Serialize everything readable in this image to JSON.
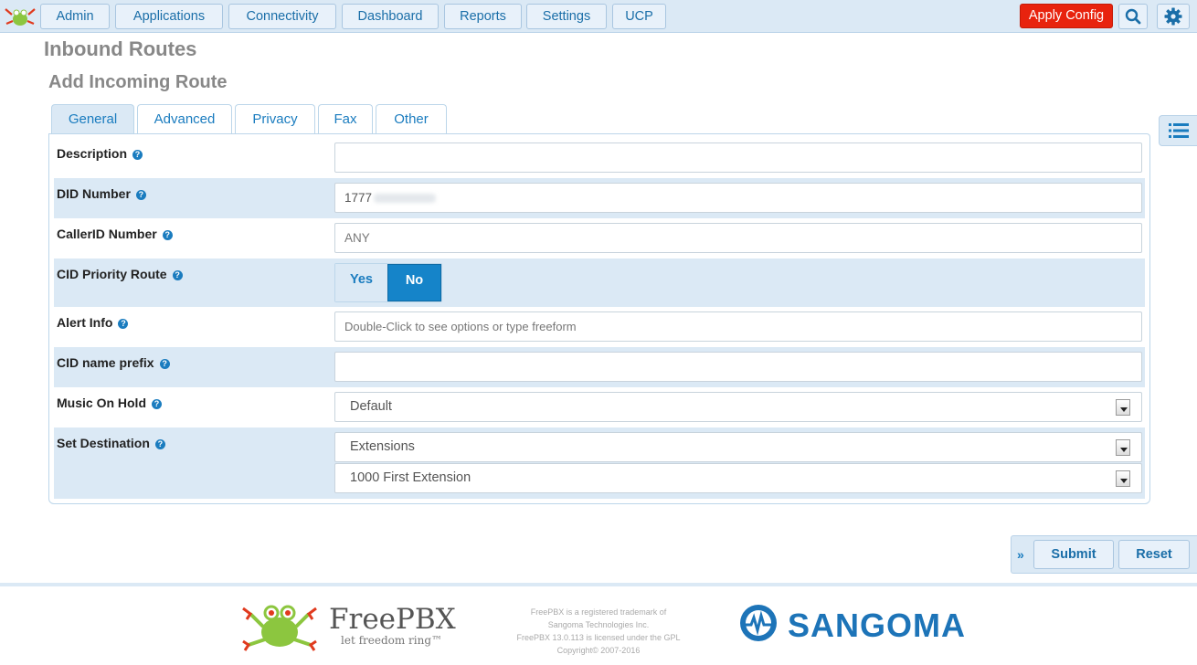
{
  "nav": {
    "items": [
      {
        "label": "Admin"
      },
      {
        "label": "Applications"
      },
      {
        "label": "Connectivity"
      },
      {
        "label": "Dashboard"
      },
      {
        "label": "Reports"
      },
      {
        "label": "Settings"
      },
      {
        "label": "UCP"
      }
    ],
    "apply_label": "Apply Config",
    "search_icon": "search-icon",
    "settings_icon": "gear-icon"
  },
  "page": {
    "title": "Inbound Routes",
    "subtitle": "Add Incoming Route"
  },
  "tabs": [
    {
      "label": "General",
      "active": true
    },
    {
      "label": "Advanced"
    },
    {
      "label": "Privacy"
    },
    {
      "label": "Fax"
    },
    {
      "label": "Other"
    }
  ],
  "form": {
    "description": {
      "label": "Description",
      "value": ""
    },
    "did": {
      "label": "DID Number",
      "value": "1777"
    },
    "callerid": {
      "label": "CallerID Number",
      "placeholder": "ANY"
    },
    "cid_priority": {
      "label": "CID Priority Route",
      "yes": "Yes",
      "no": "No",
      "selected": "No"
    },
    "alert_info": {
      "label": "Alert Info",
      "placeholder": "Double-Click to see options or type freeform"
    },
    "cid_prefix": {
      "label": "CID name prefix",
      "value": ""
    },
    "moh": {
      "label": "Music On Hold",
      "selected": "Default"
    },
    "destination": {
      "label": "Set Destination",
      "type_selected": "Extensions",
      "target_selected": "1000 First Extension"
    }
  },
  "help_glyph": "?",
  "actions": {
    "submit": "Submit",
    "reset": "Reset",
    "chevron": "»"
  },
  "footer": {
    "brand": "FreePBX",
    "tagline": "let freedom ring™",
    "legal": [
      "FreePBX is a registered trademark of",
      "Sangoma Technologies Inc.",
      "FreePBX 13.0.113 is licensed under the GPL",
      "Copyright© 2007-2016"
    ],
    "sangoma": "SANGOMA"
  },
  "colors": {
    "accent": "#1a7cbf",
    "apply": "#e8230e",
    "bar": "#dbe9f5"
  }
}
